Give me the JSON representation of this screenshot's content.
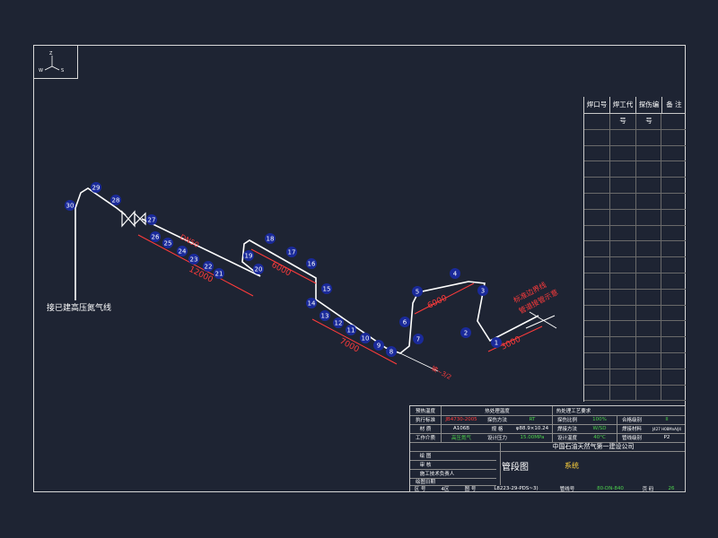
{
  "axis": {
    "z": "Z",
    "w": "W",
    "s": "S"
  },
  "annotations": {
    "connect_label": "接已建高压氮气线",
    "dim_a": "12000",
    "dim_b": "6000",
    "dim_c": "7000",
    "dim_d": "6000",
    "dim_e": "3000",
    "slope": "坡~3/2",
    "boundary_1": "标准边界线",
    "boundary_2": "管道接管示意",
    "dn_label": "DN50"
  },
  "welds": [
    "1",
    "2",
    "3",
    "4",
    "5",
    "6",
    "7",
    "8",
    "9",
    "10",
    "11",
    "12",
    "13",
    "14",
    "15",
    "16",
    "17",
    "18",
    "19",
    "20",
    "21",
    "22",
    "23",
    "24",
    "25",
    "26",
    "27",
    "28",
    "29",
    "30"
  ],
  "weld_table": {
    "headers": [
      "焊口号",
      "焊工代号",
      "探伤编号",
      "备 注"
    ],
    "row_count": 18
  },
  "title_block": {
    "r1": [
      "预热温度",
      "",
      "热处理温度",
      "",
      "热处理工艺要求",
      ""
    ],
    "r2": [
      "执行标准",
      "JB4730-2005",
      "探伤方法",
      "RT",
      "探伤比例",
      "100%",
      "合格级别",
      "II"
    ],
    "r3": [
      "材 质",
      "A106B",
      "规 格",
      "φ88.9×10.24",
      "焊接方法",
      "W/SD",
      "焊接材料",
      "J427 H08MnA/J4"
    ],
    "r4": [
      "工作介质",
      "高压氮气",
      "设计压力",
      "15.00MPa",
      "设计温度",
      "40°C",
      "管线级别",
      "P2"
    ],
    "company": "中国石油天然气第一建设公司",
    "left_rows": [
      "绘 图",
      "审 核",
      "施工技术负责人",
      "绘图日期"
    ],
    "drawing_title": "管段图",
    "title_suffix": "系统",
    "bottom": [
      "区 号",
      "4区",
      "图 号",
      "L8223-29-PDS~3)",
      "管线号",
      "80-DN-840",
      "页 码",
      "26"
    ]
  },
  "colors": {
    "bg": "#1e2433",
    "line": "#ffffff",
    "red": "#ff3b3b",
    "weld": "#1a2a9a",
    "green": "#4cd24c"
  }
}
